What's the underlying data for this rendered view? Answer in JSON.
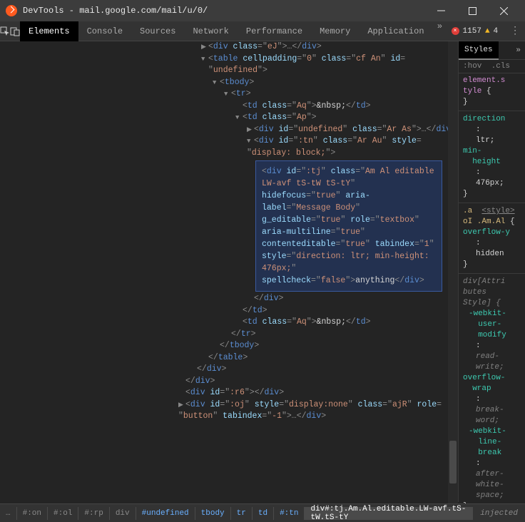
{
  "titlebar": {
    "title": "DevTools - mail.google.com/mail/u/0/"
  },
  "toolbar": {
    "tabs": [
      "Elements",
      "Console",
      "Sources",
      "Network",
      "Performance",
      "Memory",
      "Application"
    ],
    "activeTab": 0,
    "errorCount": "1157",
    "warnCount": "4"
  },
  "styles": {
    "tabLabel": "Styles",
    "hovLabel": ":hov",
    "clsLabel": ".cls",
    "blocks": [
      {
        "selector": "element.style {",
        "props": [],
        "close": "}",
        "italic": false,
        "link": ""
      },
      {
        "selector": "",
        "props": [
          {
            "name": "direction",
            "val": ""
          },
          {
            "name": "",
            "val": "ltr;"
          },
          {
            "name": "min-height",
            "val": ""
          },
          {
            "name": "",
            "val": "476px;"
          }
        ],
        "close": "}",
        "italic": false,
        "link": ""
      },
      {
        "selector": ".a",
        "link": "<style>",
        "secondLine": "oI .Am.Al {",
        "props": [
          {
            "name": "overflow-y",
            "val": ""
          },
          {
            "name": "",
            "val": "hidden"
          }
        ],
        "close": "}",
        "italic": false
      },
      {
        "selector": "div[Attributes Style] {",
        "props": [
          {
            "name": "-webkit-user-modify",
            "val": ""
          },
          {
            "name": "",
            "val": "read-write;"
          }
        ],
        "close": "",
        "italic": true
      },
      {
        "selector": "",
        "props": [
          {
            "name": "overflow-wrap",
            "val": ""
          },
          {
            "name": "",
            "val": "break-word;"
          },
          {
            "name": "-webkit-line-break",
            "val": ""
          },
          {
            "name": "",
            "val": "after-white-space;"
          }
        ],
        "close": "}",
        "italic": false
      }
    ],
    "injected": "injected"
  },
  "breadcrumbs": [
    "…",
    "#:on",
    "#:ol",
    "#:rp",
    "div",
    "#undefined",
    "tbody",
    "tr",
    "td",
    "#:tn",
    "div#:tj.Am.Al.editable.LW-avf.tS-tW.tS-tY"
  ],
  "tree": {
    "l1": {
      "pre": "<div ",
      "a": [
        [
          "class",
          "eJ"
        ]
      ],
      "post": ">…</div>"
    },
    "l2": {
      "pre": "<table ",
      "a": [
        [
          "cellpadding",
          "0"
        ],
        [
          "class",
          "cf An"
        ],
        [
          "id",
          "undefined"
        ]
      ],
      "post": ">"
    },
    "l3": "<tbody>",
    "l4": "<tr>",
    "l5": {
      "pre": "<td ",
      "a": [
        [
          "class",
          "Aq"
        ]
      ],
      "post": ">&nbsp;</td>"
    },
    "l6": {
      "pre": "<td ",
      "a": [
        [
          "class",
          "Ap"
        ]
      ],
      "post": ">"
    },
    "l7": {
      "pre": "<div ",
      "a": [
        [
          "id",
          "undefined"
        ],
        [
          "class",
          "Ar As"
        ]
      ],
      "post": ">…</div>"
    },
    "l8a": {
      "pre": "<div ",
      "a": [
        [
          "id",
          ":tn"
        ],
        [
          "class",
          "Ar Au"
        ],
        [
          "style",
          "display: block;"
        ]
      ],
      "post": ">"
    },
    "hl": {
      "open": "<div",
      "attrs": [
        [
          "id",
          ":tj"
        ],
        [
          "class",
          "Am Al editable LW-avf tS-tW tS-tY"
        ],
        [
          "hidefocus",
          "true"
        ],
        [
          "aria-label",
          "Message Body"
        ],
        [
          "g_editable",
          "true"
        ],
        [
          "role",
          "textbox"
        ],
        [
          "aria-multiline",
          "true"
        ],
        [
          "contenteditable",
          "true"
        ],
        [
          "tabindex",
          "1"
        ],
        [
          "style",
          "direction: ltr; min-height: 476px;"
        ],
        [
          "spellcheck",
          "false"
        ]
      ],
      "text": "anything",
      "close": "</div>"
    },
    "l9": "</div>",
    "l10": "</td>",
    "l11": {
      "pre": "<td ",
      "a": [
        [
          "class",
          "Aq"
        ]
      ],
      "post": ">&nbsp;</td>"
    },
    "l12": "</tr>",
    "l13": "</tbody>",
    "l14": "</table>",
    "l15": "</div>",
    "l16": "</div>",
    "l17": {
      "pre": "<div ",
      "a": [
        [
          "id",
          ":r6"
        ]
      ],
      "post": "></div>"
    },
    "l18": {
      "pre": "<div ",
      "a": [
        [
          "id",
          ":oj"
        ],
        [
          "style",
          "display:none"
        ],
        [
          "class",
          "ajR"
        ],
        [
          "role",
          "button"
        ],
        [
          "tabindex",
          "-1"
        ]
      ],
      "post": ">…</div>"
    }
  }
}
